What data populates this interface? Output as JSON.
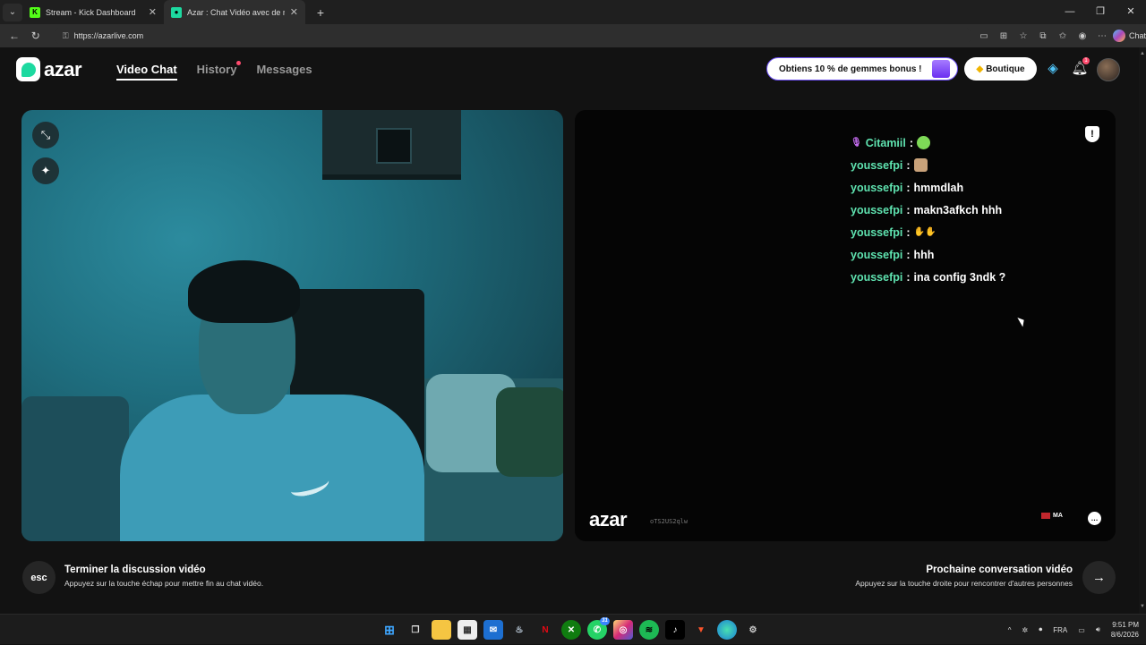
{
  "browser": {
    "tabs": [
      {
        "title": "Stream - Kick Dashboard",
        "favicon": "kick-icon",
        "active": false
      },
      {
        "title": "Azar : Chat Vidéo avec de nou",
        "favicon": "azar-icon",
        "active": true
      }
    ],
    "new_tab": "+",
    "url": "https://azarlive.com",
    "copilot_label": "Chat"
  },
  "header": {
    "logo_text": "azar",
    "nav": [
      {
        "label": "Video Chat",
        "active": true
      },
      {
        "label": "History",
        "has_dot": true
      },
      {
        "label": "Messages"
      }
    ],
    "promo_label": "Obtiens 10 % de gemmes bonus !",
    "shop_label": "Boutique",
    "notification_count": "1"
  },
  "remote_chat": {
    "messages": [
      {
        "user": "Citamiil",
        "text": "",
        "emoji": "gift-emoji",
        "has_mic": true
      },
      {
        "user": "youssefpi",
        "text": "",
        "emoji": "cat-emoji"
      },
      {
        "user": "youssefpi",
        "text": "hmmdlah"
      },
      {
        "user": "youssefpi",
        "text": "makn3afkch hhh"
      },
      {
        "user": "youssefpi",
        "text": "",
        "emoji": "pray-emoji"
      },
      {
        "user": "youssefpi",
        "text": "hhh"
      },
      {
        "user": "youssefpi",
        "text": "ina config 3ndk ?"
      }
    ],
    "watermark": "azar",
    "room_id": "oTS2US2qlw",
    "country_code": "MA"
  },
  "footer": {
    "esc_key": "esc",
    "end_title": "Terminer la discussion vidéo",
    "end_sub": "Appuyez sur la touche échap pour mettre fin au chat vidéo.",
    "next_title": "Prochaine conversation vidéo",
    "next_sub": "Appuyez sur la touche droite pour rencontrer d'autres personnes"
  },
  "taskbar": {
    "whatsapp_badge": "31",
    "lang": "FRA",
    "time": "9:51 PM",
    "date": "8/6/2026"
  },
  "colors": {
    "accent": "#1dd9a0",
    "username": "#5fe3b0",
    "alert": "#ff4b6e"
  }
}
